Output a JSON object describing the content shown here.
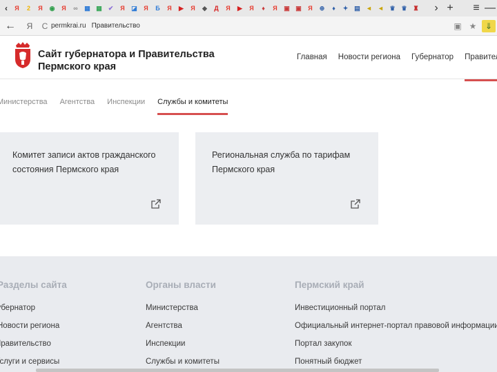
{
  "browser": {
    "tab_favicons": [
      {
        "icon": "yandex-icon",
        "glyph": "Я",
        "color": "#e63b2e"
      },
      {
        "icon": "square-icon",
        "glyph": "2",
        "color": "#f0b400"
      },
      {
        "icon": "yandex-icon",
        "glyph": "Я",
        "color": "#e63b2e"
      },
      {
        "icon": "shield-icon",
        "glyph": "◉",
        "color": "#2e9e4a"
      },
      {
        "icon": "yandex-icon",
        "glyph": "Я",
        "color": "#e63b2e"
      },
      {
        "icon": "infinity-icon",
        "glyph": "∞",
        "color": "#8a8a8a"
      },
      {
        "icon": "grid-icon",
        "glyph": "▦",
        "color": "#2f7bd6"
      },
      {
        "icon": "grid-icon",
        "glyph": "▦",
        "color": "#3aa75a"
      },
      {
        "icon": "check-icon",
        "glyph": "✔",
        "color": "#8b6fd6"
      },
      {
        "icon": "yandex-icon",
        "glyph": "Я",
        "color": "#e63b2e"
      },
      {
        "icon": "flag-icon",
        "glyph": "◪",
        "color": "#2f7bd6"
      },
      {
        "icon": "yandex-icon",
        "glyph": "Я",
        "color": "#e63b2e"
      },
      {
        "icon": "doc-icon",
        "glyph": "Б",
        "color": "#2f7bd6"
      },
      {
        "icon": "yandex-icon",
        "glyph": "Я",
        "color": "#e63b2e"
      },
      {
        "icon": "video-icon",
        "glyph": "▶",
        "color": "#d62020"
      },
      {
        "icon": "yandex-icon",
        "glyph": "Я",
        "color": "#e63b2e"
      },
      {
        "icon": "play-icon",
        "glyph": "◆",
        "color": "#555555"
      },
      {
        "icon": "alert-icon",
        "glyph": "Д",
        "color": "#d62020"
      },
      {
        "icon": "yandex-icon",
        "glyph": "Я",
        "color": "#e63b2e"
      },
      {
        "icon": "video-icon",
        "glyph": "▶",
        "color": "#d62020"
      },
      {
        "icon": "yandex-icon",
        "glyph": "Я",
        "color": "#e63b2e"
      },
      {
        "icon": "coat-of-arms-icon",
        "glyph": "♦",
        "color": "#c93a3a"
      },
      {
        "icon": "yandex-icon",
        "glyph": "Я",
        "color": "#e63b2e"
      },
      {
        "icon": "box-icon",
        "glyph": "▣",
        "color": "#c93a3a"
      },
      {
        "icon": "box-icon",
        "glyph": "▣",
        "color": "#c93a3a"
      },
      {
        "icon": "yandex-icon",
        "glyph": "Я",
        "color": "#e63b2e"
      },
      {
        "icon": "globe-icon",
        "glyph": "⊕",
        "color": "#2f5fa8"
      },
      {
        "icon": "coat-of-arms-icon",
        "glyph": "♦",
        "color": "#2f5fa8"
      },
      {
        "icon": "star-icon",
        "glyph": "✦",
        "color": "#2f5fa8"
      },
      {
        "icon": "emblem-icon",
        "glyph": "▤",
        "color": "#2f5fa8"
      },
      {
        "icon": "arrow-icon",
        "glyph": "◄",
        "color": "#c9a400"
      },
      {
        "icon": "arrow-icon",
        "glyph": "◄",
        "color": "#c9a400"
      },
      {
        "icon": "emblem-icon",
        "glyph": "♛",
        "color": "#2f5fa8"
      },
      {
        "icon": "emblem-icon",
        "glyph": "♛",
        "color": "#2f5fa8"
      },
      {
        "icon": "perm-emblem-icon",
        "glyph": "♜",
        "color": "#c62d2d"
      }
    ],
    "url": "permkrai.ru",
    "breadcrumb": "Правительство",
    "back_glyph": "←",
    "yandex_glyph": "Я",
    "reload_glyph": "C",
    "chevron_glyph": "‹",
    "tabs_more_glyph": "›",
    "new_tab_glyph": "+",
    "menu_glyph": "≡",
    "minimize_glyph": "—",
    "download_glyph": "⇓",
    "bookmark_glyph": "★",
    "reader_glyph": "▣"
  },
  "site": {
    "title_line1": "Сайт губернатора и Правительства",
    "title_line2": "Пермского края",
    "emblem_color": "#d62b2b"
  },
  "nav": {
    "items": [
      {
        "label": "Главная"
      },
      {
        "label": "Новости региона"
      },
      {
        "label": "Губернатор"
      },
      {
        "label": "Правительство"
      }
    ],
    "active_color": "#d64f4f"
  },
  "subtabs": [
    {
      "label": "Министерства"
    },
    {
      "label": "Агентства"
    },
    {
      "label": "Инспекции"
    },
    {
      "label": "Службы и комитеты"
    }
  ],
  "cards": [
    {
      "title": "Комитет записи актов гражданского состояния Пермского края"
    },
    {
      "title": "Региональная служба по тарифам Пермского края"
    }
  ],
  "footer": {
    "columns": [
      {
        "heading": "Разделы сайта",
        "links": [
          "Губернатор",
          "Новости региона",
          "Правительство",
          "Услуги и сервисы"
        ]
      },
      {
        "heading": "Органы власти",
        "links": [
          "Министерства",
          "Агентства",
          "Инспекции",
          "Службы и комитеты"
        ]
      },
      {
        "heading": "Пермский край",
        "links": [
          "Инвестиционный портал",
          "Официальный интернет-портал правовой информации",
          "Портал закупок",
          "Понятный бюджет"
        ]
      }
    ]
  }
}
